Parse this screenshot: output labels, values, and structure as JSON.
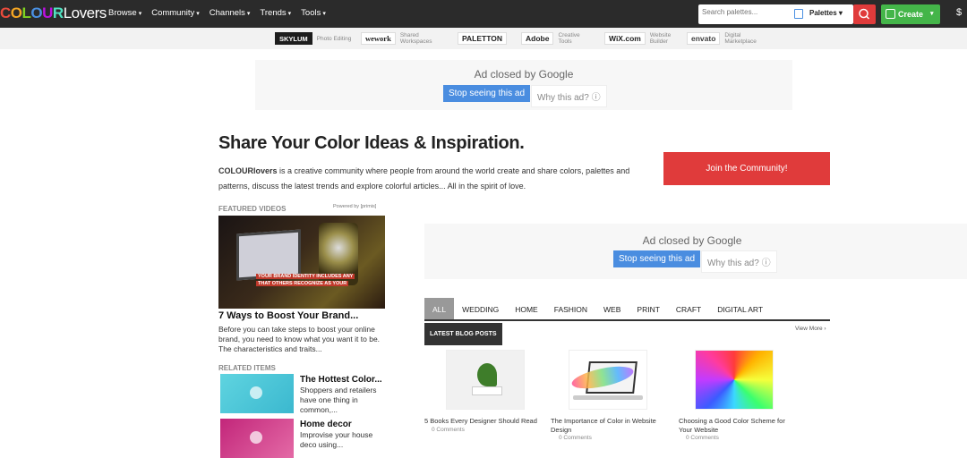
{
  "header": {
    "logo": {
      "letters": [
        "C",
        "O",
        "L",
        "O",
        "U",
        "R"
      ],
      "suffix": "Lovers"
    },
    "nav": [
      {
        "label": "Browse"
      },
      {
        "label": "Community"
      },
      {
        "label": "Channels"
      },
      {
        "label": "Trends"
      },
      {
        "label": "Tools"
      }
    ],
    "search_placeholder": "Search palettes...",
    "search_type": "Palettes",
    "create_label": "Create"
  },
  "sponsors": [
    {
      "name": "SKYLUM",
      "sub": "Photo Editing"
    },
    {
      "name": "wework",
      "sub": "Shared Workspaces"
    },
    {
      "name": "PALETTON",
      "sub": ""
    },
    {
      "name": "Adobe",
      "sub": "Creative Tools"
    },
    {
      "name": "WiX.com",
      "sub": "Website Builder"
    },
    {
      "name": "envato",
      "sub": "Digital Marketplace"
    }
  ],
  "ad_top": {
    "closed_text": "Ad closed by Google",
    "stop_label": "Stop seeing this ad",
    "why_label": "Why this ad? ⓘ"
  },
  "ad_mid": {
    "closed_text": "Ad closed by Google",
    "stop_label": "Stop seeing this ad",
    "why_label": "Why this ad? ⓘ"
  },
  "main": {
    "headline": "Share Your Color Ideas & Inspiration.",
    "intro_brand": "COLOURlovers",
    "intro_text": " is a creative community where people from around the world create and share colors, palettes and patterns, discuss the latest trends and explore colorful articles... All in the spirit of love.",
    "join_label": "Join the Community!"
  },
  "featured": {
    "section_label": "Featured Videos",
    "powered_by": "Powered by [primis]",
    "video_caption_1": "Your brand identity includes any",
    "video_caption_2": "that others recognize as your",
    "video_title": "7 Ways to Boost Your Brand...",
    "video_desc": "Before you can take steps to boost your online brand, you need to know what you want it to be. The characteristics and traits..."
  },
  "related": {
    "section_label": "Related Items",
    "items": [
      {
        "title": "The Hottest Color...",
        "desc": "Shoppers and retailers have one thing in common,..."
      },
      {
        "title": "Home decor",
        "desc": "Improvise your house deco using..."
      }
    ]
  },
  "blog": {
    "tabs": [
      "All",
      "Wedding",
      "Home",
      "Fashion",
      "Web",
      "Print",
      "Craft",
      "Digital Art"
    ],
    "active_tab": "All",
    "section_label": "Latest Blog Posts",
    "view_more": "View More ›",
    "posts": [
      {
        "title": "5 Books Every Designer Should Read",
        "comments": "0 Comments"
      },
      {
        "title": "The Importance of Color in Website Design",
        "comments": "0 Comments"
      },
      {
        "title": "Choosing a Good Color Scheme for Your Website",
        "comments": "0 Comments"
      }
    ]
  }
}
